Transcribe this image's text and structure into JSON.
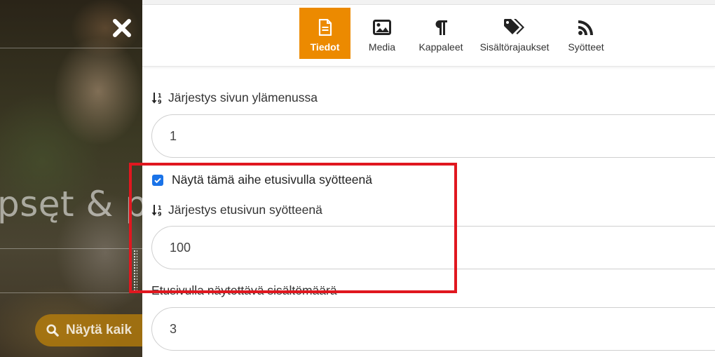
{
  "background": {
    "title_fragment": "psęt & p",
    "search_button_label": "Näytä kaik"
  },
  "tabs": [
    {
      "label": "Tiedot",
      "icon": "document-icon",
      "active": true
    },
    {
      "label": "Media",
      "icon": "image-icon",
      "active": false
    },
    {
      "label": "Kappaleet",
      "icon": "paragraph-icon",
      "active": false
    },
    {
      "label": "Sisältörajaukset",
      "icon": "tags-icon",
      "active": false
    },
    {
      "label": "Syötteet",
      "icon": "rss-icon",
      "active": false
    }
  ],
  "fields": {
    "menu_order": {
      "label": "Järjestys sivun ylämenussa",
      "value": "1"
    },
    "show_on_front": {
      "label": "Näytä tämä aihe etusivulla syötteenä",
      "checked": true
    },
    "front_order": {
      "label": "Järjestys etusivun syötteenä",
      "value": "100"
    },
    "front_count": {
      "label": "Etusivulla näytettävä sisältömäärä",
      "value": "3"
    }
  },
  "colors": {
    "accent": "#ec8a00",
    "checkbox": "#1a73e8",
    "highlight": "#e0171f"
  }
}
